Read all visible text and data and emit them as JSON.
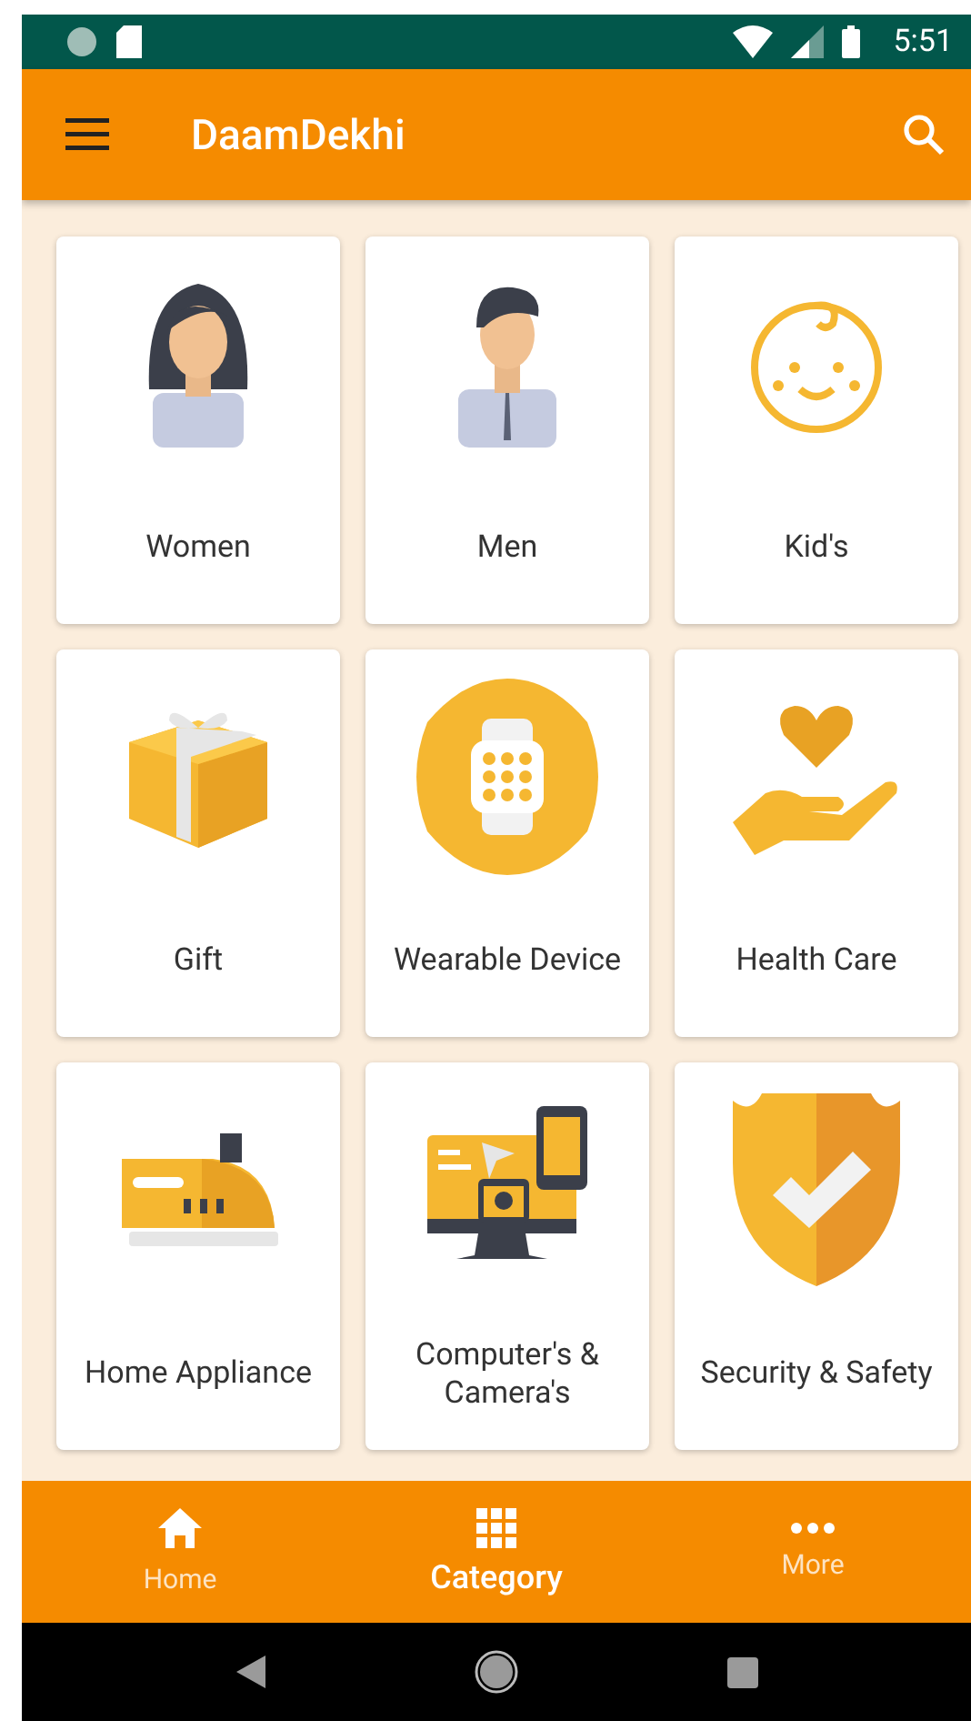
{
  "status_bar": {
    "time": "5:51"
  },
  "app_bar": {
    "title": "DaamDekhi"
  },
  "categories": [
    {
      "label": "Women"
    },
    {
      "label": "Men"
    },
    {
      "label": "Kid's"
    },
    {
      "label": "Gift"
    },
    {
      "label": "Wearable Device"
    },
    {
      "label": "Health Care"
    },
    {
      "label": "Home Appliance"
    },
    {
      "label": "Computer's & Camera's"
    },
    {
      "label": "Security & Safety"
    }
  ],
  "bottom_nav": [
    {
      "label": "Home",
      "selected": false
    },
    {
      "label": "Category",
      "selected": true
    },
    {
      "label": "More",
      "selected": false
    }
  ]
}
